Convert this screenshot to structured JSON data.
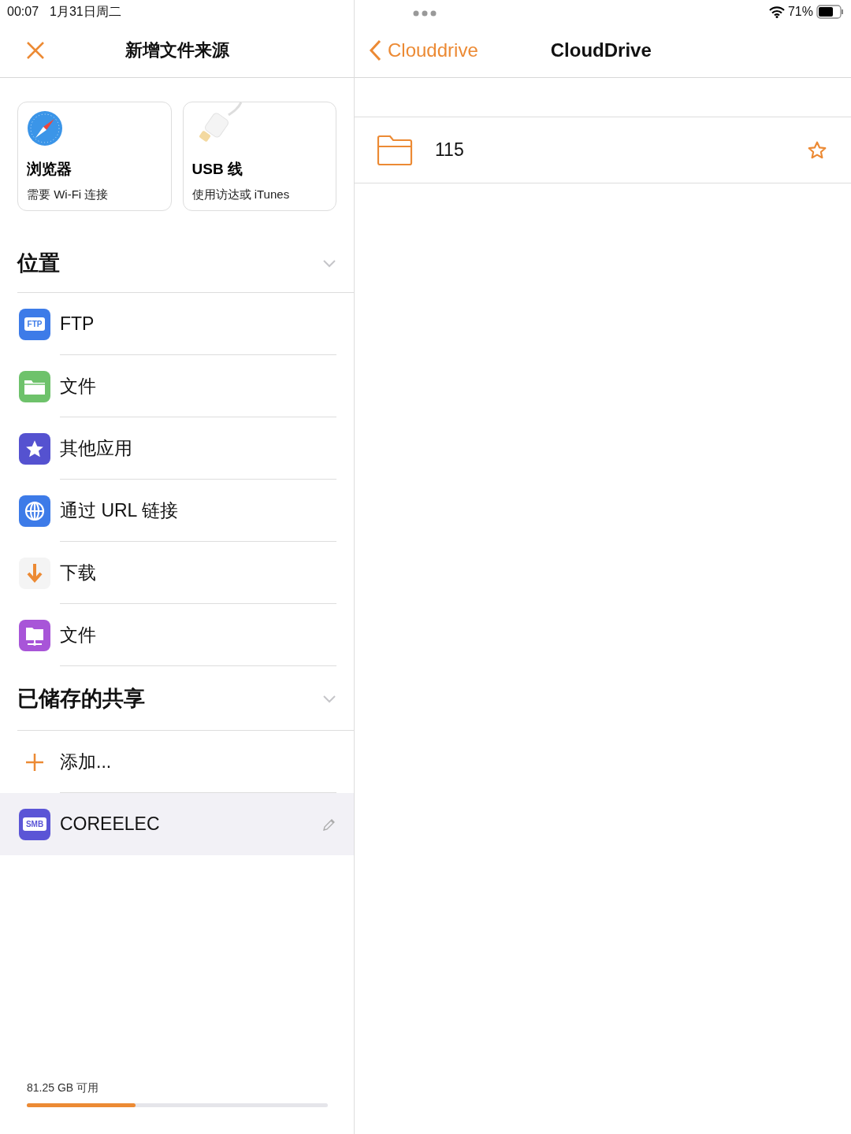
{
  "status_bar": {
    "time": "00:07",
    "date": "1月31日周二",
    "battery": "71%"
  },
  "left_pane": {
    "title": "新增文件来源",
    "cards": [
      {
        "kind": "browser",
        "title": "浏览器",
        "subtitle": "需要 Wi-Fi 连接"
      },
      {
        "kind": "usb",
        "title": "USB 线",
        "subtitle": "使用访达或 iTunes"
      }
    ],
    "sections": [
      {
        "title": "位置",
        "expanded": true,
        "items": [
          {
            "kind": "ftp",
            "label": "FTP",
            "badge": "FTP",
            "selected": false
          },
          {
            "kind": "files",
            "label": "文件",
            "selected": false
          },
          {
            "kind": "apps",
            "label": "其他应用",
            "selected": false
          },
          {
            "kind": "url",
            "label": "通过 URL 链接",
            "selected": false
          },
          {
            "kind": "download",
            "label": "下载",
            "selected": false
          },
          {
            "kind": "network",
            "label": "文件",
            "selected": false
          }
        ]
      },
      {
        "title": "已储存的共享",
        "expanded": true,
        "items": [
          {
            "kind": "add",
            "label": "添加...",
            "selected": false
          },
          {
            "kind": "smb",
            "label": "COREELEC",
            "badge": "SMB",
            "selected": true,
            "editable": true
          }
        ]
      }
    ],
    "storage": {
      "label": "81.25 GB 可用",
      "level": 0.36
    }
  },
  "right_pane": {
    "back_label": "Clouddrive",
    "title": "CloudDrive",
    "rows": [
      {
        "name": "115",
        "favorite": false
      }
    ]
  }
}
